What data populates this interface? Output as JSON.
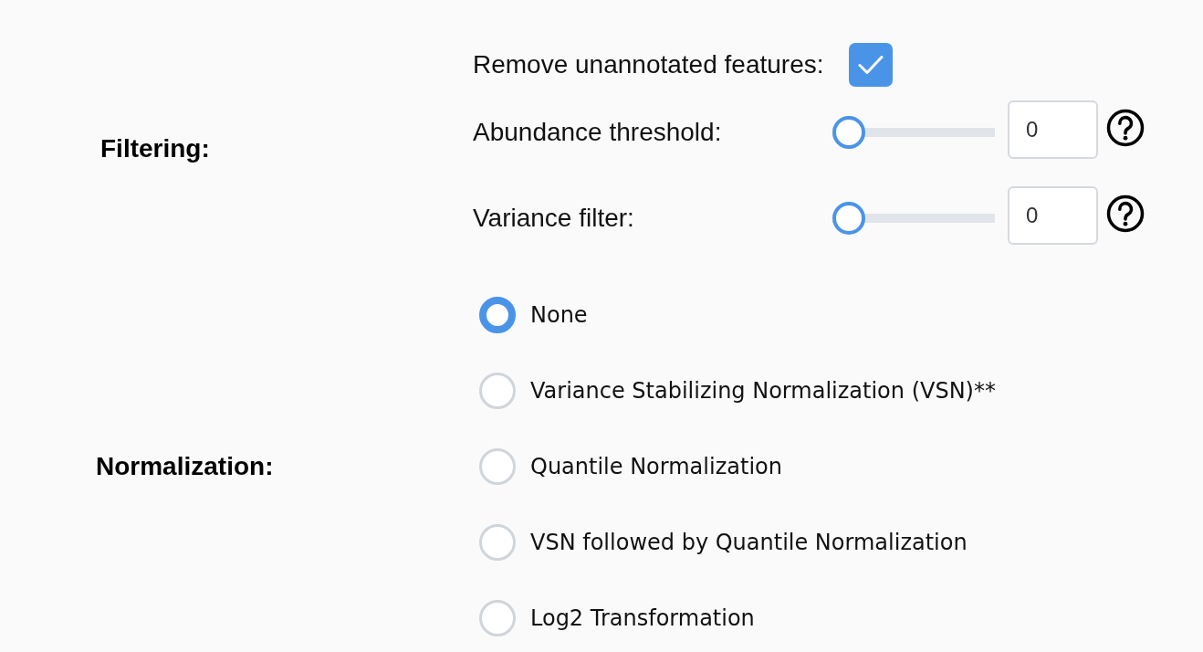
{
  "filtering": {
    "label": "Filtering:",
    "controls": [
      {
        "kind": "checkbox",
        "label": "Remove unannotated features:",
        "checked": true
      },
      {
        "kind": "slider",
        "label": "Abundance threshold:",
        "level": 0,
        "value": "0"
      },
      {
        "kind": "slider",
        "label": "Variance filter:",
        "level": 0,
        "value": "0"
      }
    ]
  },
  "normalization": {
    "label": "Normalization:",
    "options": [
      {
        "label": "None",
        "selected": true
      },
      {
        "label": "Variance Stabilizing Normalization (VSN)**",
        "selected": false
      },
      {
        "label": "Quantile Normalization",
        "selected": false
      },
      {
        "label": "VSN followed by Quantile Normalization",
        "selected": false
      },
      {
        "label": "Log2 Transformation",
        "selected": false
      }
    ]
  }
}
